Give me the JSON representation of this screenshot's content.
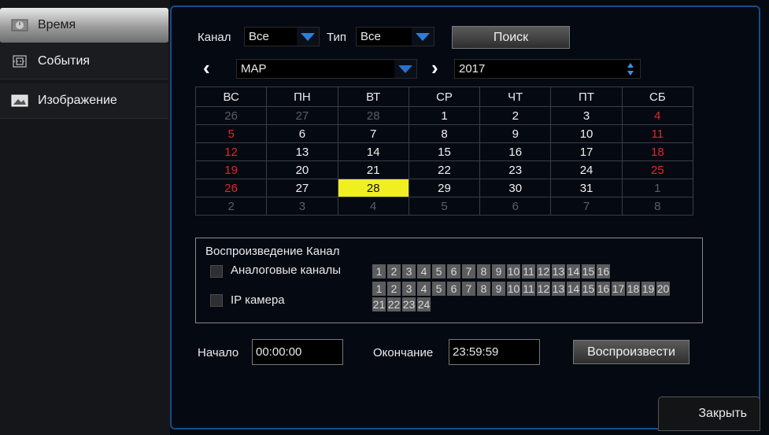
{
  "sidebar": {
    "items": [
      {
        "label": "Время",
        "icon": "clock-icon",
        "active": true
      },
      {
        "label": "События",
        "icon": "event-icon",
        "active": false
      },
      {
        "label": "Изображение",
        "icon": "image-icon",
        "active": false
      }
    ]
  },
  "filter": {
    "channel_label": "Канал",
    "channel_value": "Все",
    "type_label": "Тип",
    "type_value": "Все",
    "search_button": "Поиск"
  },
  "month_nav": {
    "month": "МАР",
    "year": "2017"
  },
  "calendar": {
    "weekdays": [
      "ВС",
      "ПН",
      "ВТ",
      "СР",
      "ЧТ",
      "ПТ",
      "СБ"
    ],
    "weeks": [
      [
        {
          "d": "26",
          "s": "dim"
        },
        {
          "d": "27",
          "s": "dim"
        },
        {
          "d": "28",
          "s": "dim"
        },
        {
          "d": "1",
          "s": "norm"
        },
        {
          "d": "2",
          "s": "norm"
        },
        {
          "d": "3",
          "s": "norm"
        },
        {
          "d": "4",
          "s": "red"
        }
      ],
      [
        {
          "d": "5",
          "s": "red"
        },
        {
          "d": "6",
          "s": "norm"
        },
        {
          "d": "7",
          "s": "norm"
        },
        {
          "d": "8",
          "s": "norm"
        },
        {
          "d": "9",
          "s": "norm"
        },
        {
          "d": "10",
          "s": "norm"
        },
        {
          "d": "11",
          "s": "red"
        }
      ],
      [
        {
          "d": "12",
          "s": "red"
        },
        {
          "d": "13",
          "s": "norm"
        },
        {
          "d": "14",
          "s": "norm"
        },
        {
          "d": "15",
          "s": "norm"
        },
        {
          "d": "16",
          "s": "norm"
        },
        {
          "d": "17",
          "s": "norm"
        },
        {
          "d": "18",
          "s": "red"
        }
      ],
      [
        {
          "d": "19",
          "s": "red"
        },
        {
          "d": "20",
          "s": "norm"
        },
        {
          "d": "21",
          "s": "norm"
        },
        {
          "d": "22",
          "s": "norm"
        },
        {
          "d": "23",
          "s": "norm"
        },
        {
          "d": "24",
          "s": "norm"
        },
        {
          "d": "25",
          "s": "red"
        }
      ],
      [
        {
          "d": "26",
          "s": "red"
        },
        {
          "d": "27",
          "s": "norm"
        },
        {
          "d": "28",
          "s": "sel28"
        },
        {
          "d": "29",
          "s": "norm"
        },
        {
          "d": "30",
          "s": "norm"
        },
        {
          "d": "31",
          "s": "norm"
        },
        {
          "d": "1",
          "s": "dim"
        }
      ],
      [
        {
          "d": "2",
          "s": "dim"
        },
        {
          "d": "3",
          "s": "dim"
        },
        {
          "d": "4",
          "s": "dim"
        },
        {
          "d": "5",
          "s": "dim"
        },
        {
          "d": "6",
          "s": "dim"
        },
        {
          "d": "7",
          "s": "dim"
        },
        {
          "d": "8",
          "s": "dim"
        }
      ]
    ],
    "selected_day": "28"
  },
  "playback": {
    "title": "Воспроизведение Канал",
    "analog_label": "Аналоговые каналы",
    "ip_label": "IP камера",
    "analog_channels": [
      "1",
      "2",
      "3",
      "4",
      "5",
      "6",
      "7",
      "8",
      "9",
      "10",
      "11",
      "12",
      "13",
      "14",
      "15",
      "16"
    ],
    "ip_channels": [
      "1",
      "2",
      "3",
      "4",
      "5",
      "6",
      "7",
      "8",
      "9",
      "10",
      "11",
      "12",
      "13",
      "14",
      "15",
      "16",
      "17",
      "18",
      "19",
      "20",
      "21",
      "22",
      "23",
      "24"
    ]
  },
  "time": {
    "start_label": "Начало",
    "start_value": "00:00:00",
    "end_label": "Окончание",
    "end_value": "23:59:59",
    "play_button": "Воспроизвести"
  },
  "close_button": "Закрыть",
  "colors": {
    "accent": "#1b4a8a",
    "weekend": "#e0262a",
    "selected": "#f0ef22"
  }
}
